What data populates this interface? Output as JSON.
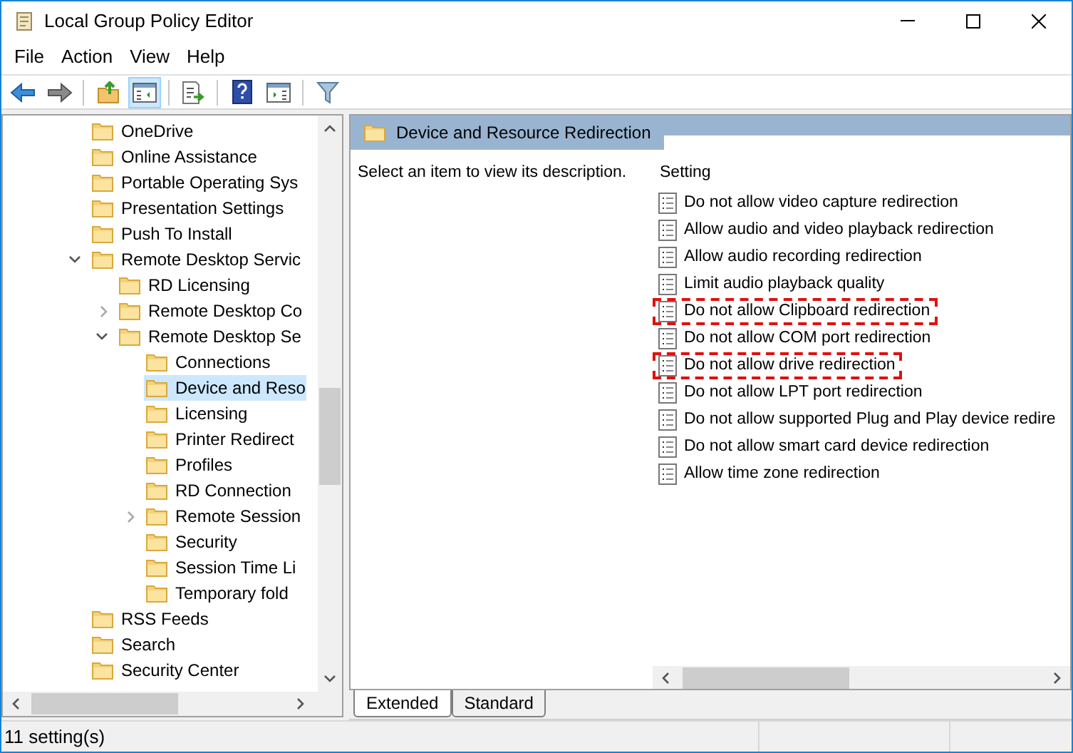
{
  "window": {
    "title": "Local Group Policy Editor"
  },
  "menu": [
    "File",
    "Action",
    "View",
    "Help"
  ],
  "toolbar": [
    {
      "kind": "back",
      "pressed": false
    },
    {
      "kind": "forward",
      "pressed": false
    },
    {
      "kind": "sep"
    },
    {
      "kind": "up",
      "pressed": false
    },
    {
      "kind": "tree",
      "pressed": true
    },
    {
      "kind": "sep"
    },
    {
      "kind": "export",
      "pressed": false
    },
    {
      "kind": "sep"
    },
    {
      "kind": "help",
      "pressed": false
    },
    {
      "kind": "pane",
      "pressed": false
    },
    {
      "kind": "sep"
    },
    {
      "kind": "filter",
      "pressed": false
    }
  ],
  "tree": [
    {
      "label": "OneDrive",
      "selected": false
    },
    {
      "label": "Online Assistance",
      "selected": false
    },
    {
      "label": "Portable Operating Sys",
      "selected": false
    },
    {
      "label": "Presentation Settings",
      "selected": false
    },
    {
      "label": "Push To Install",
      "selected": false
    },
    {
      "label": "Remote Desktop Servic",
      "selected": false,
      "expanded": true,
      "children": [
        {
          "label": "RD Licensing",
          "selected": false
        },
        {
          "label": "Remote Desktop Co",
          "selected": false,
          "expanded": false
        },
        {
          "label": "Remote Desktop Se",
          "selected": false,
          "expanded": true,
          "children": [
            {
              "label": "Connections",
              "selected": false
            },
            {
              "label": "Device and Reso",
              "selected": true
            },
            {
              "label": "Licensing",
              "selected": false
            },
            {
              "label": "Printer Redirect",
              "selected": false
            },
            {
              "label": "Profiles",
              "selected": false
            },
            {
              "label": "RD Connection",
              "selected": false
            },
            {
              "label": "Remote Session",
              "selected": false,
              "expanded": false
            },
            {
              "label": "Security",
              "selected": false
            },
            {
              "label": "Session Time Li",
              "selected": false
            },
            {
              "label": "Temporary fold",
              "selected": false
            }
          ]
        }
      ]
    },
    {
      "label": "RSS Feeds",
      "selected": false
    },
    {
      "label": "Search",
      "selected": false
    },
    {
      "label": "Security Center",
      "selected": false
    }
  ],
  "details": {
    "title": "Device and Resource Redirection",
    "description": "Select an item to view its description.",
    "column": "Setting",
    "settings": [
      {
        "name": "Do not allow video capture redirection",
        "highlighted": false
      },
      {
        "name": "Allow audio and video playback redirection",
        "highlighted": false
      },
      {
        "name": "Allow audio recording redirection",
        "highlighted": false
      },
      {
        "name": "Limit audio playback quality",
        "highlighted": false
      },
      {
        "name": "Do not allow Clipboard redirection",
        "highlighted": true
      },
      {
        "name": "Do not allow COM port redirection",
        "highlighted": false
      },
      {
        "name": "Do not allow drive redirection",
        "highlighted": true
      },
      {
        "name": "Do not allow LPT port redirection",
        "highlighted": false
      },
      {
        "name": "Do not allow supported Plug and Play device redire",
        "highlighted": false
      },
      {
        "name": "Do not allow smart card device redirection",
        "highlighted": false
      },
      {
        "name": "Allow time zone redirection",
        "highlighted": false
      }
    ]
  },
  "tabs": [
    {
      "label": "Extended",
      "selected": true
    },
    {
      "label": "Standard",
      "selected": false
    }
  ],
  "status_bar": "11 setting(s)"
}
